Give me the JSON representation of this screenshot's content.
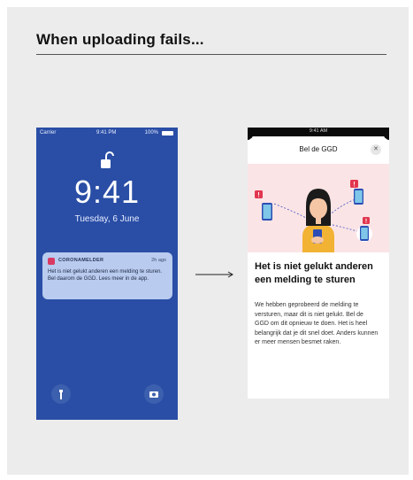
{
  "heading": "When uploading fails...",
  "lock_screen": {
    "status": {
      "carrier": "Carrier",
      "time": "9:41 PM",
      "battery": "100%"
    },
    "clock": "9:41",
    "date": "Tuesday, 6 June",
    "notification": {
      "app_name": "CORONAMELDER",
      "ago": "2h ago",
      "body": "Het is niet gelukt anderen een melding te sturen. Bel daarom de GGD. Lees meer in de app."
    }
  },
  "app_screen": {
    "status_time": "9:41 AM",
    "sheet_title": "Bel de GGD",
    "close_label": "✕",
    "title": "Het is niet gelukt anderen een melding te sturen",
    "body": "We hebben geprobeerd de melding te versturen, maar dit is niet gelukt. Bel de GGD om dit opnieuw te doen. Het is heel belangrijk dat je dit snel doet. Anders kunnen er meer mensen besmet raken."
  },
  "colors": {
    "lock_bg": "#2a4ea6",
    "notification_bg": "#b9cbef",
    "illustration_bg": "#fbe4e6",
    "accent_red": "#e2364f",
    "accent_yellow": "#f2b234",
    "phone_blue": "#7fc6e8"
  },
  "icons": [
    "lock-open-icon",
    "flashlight-icon",
    "camera-icon",
    "close-icon",
    "arrow-right-icon",
    "app-icon"
  ]
}
